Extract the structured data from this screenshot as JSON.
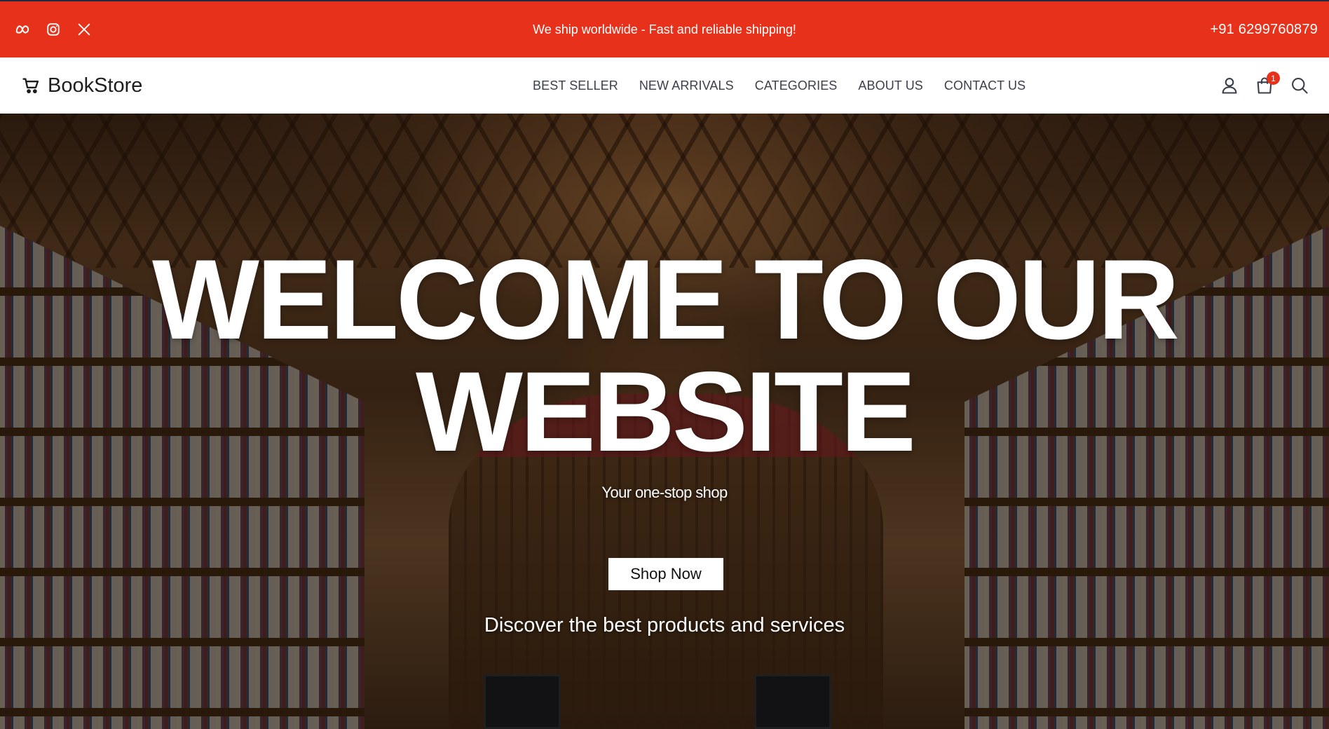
{
  "topbar": {
    "announcement": "We ship worldwide - Fast and reliable shipping!",
    "phone": "+91 6299760879",
    "social_icons": [
      "meta-icon",
      "instagram-icon",
      "x-icon"
    ],
    "background_color": "#e8311a"
  },
  "navbar": {
    "brand_name": "BookStore",
    "brand_icon": "cart-icon",
    "menu": [
      "BEST SELLER",
      "NEW ARRIVALS",
      "CATEGORIES",
      "ABOUT US",
      "CONTACT US"
    ],
    "icons": [
      "user-icon",
      "shopping-bag-icon",
      "search-icon"
    ],
    "cart_count": "1"
  },
  "hero": {
    "title_line1": "WELCOME TO OUR",
    "title_line2": "WEBSITE",
    "subtitle": "Your one-stop shop",
    "cta_label": "Shop Now",
    "tagline": "Discover the best products and services",
    "background_image": "bookstore-library-interior"
  }
}
